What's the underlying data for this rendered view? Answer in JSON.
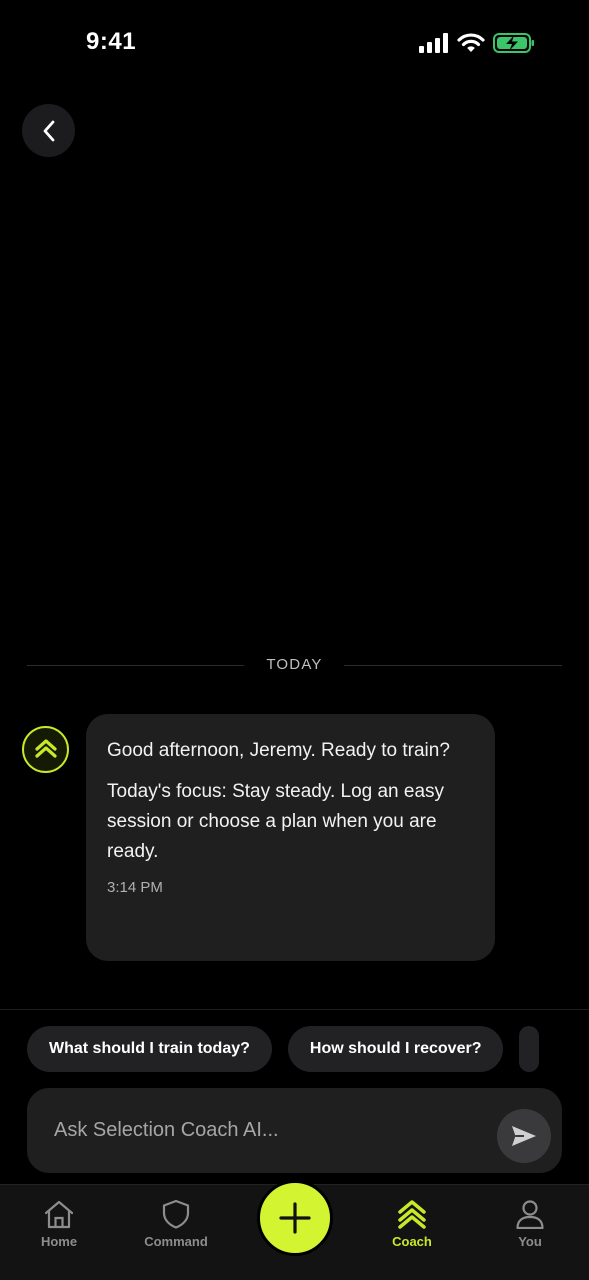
{
  "status_bar": {
    "time": "9:41"
  },
  "conversation": {
    "date_label": "TODAY",
    "message": {
      "line1": "Good afternoon, Jeremy. Ready to train?",
      "line2": "Today's focus: Stay steady. Log an easy session or choose a plan when you are ready.",
      "time": "3:14 PM"
    }
  },
  "suggestions": [
    "What should I train today?",
    "How should I recover?"
  ],
  "composer": {
    "placeholder": "Ask Selection Coach AI..."
  },
  "tab_bar": {
    "items": [
      {
        "label": "Home",
        "icon": "home-icon",
        "active": false
      },
      {
        "label": "Command",
        "icon": "shield-icon",
        "active": false
      },
      {
        "label": "Coach",
        "icon": "chevrons-up-icon",
        "active": true
      },
      {
        "label": "You",
        "icon": "person-icon",
        "active": false
      }
    ],
    "fab_icon": "plus-icon"
  },
  "colors": {
    "accent": "#c7e92a",
    "fab": "#d3f531",
    "bubble": "#1f1f1f",
    "background": "#000000"
  }
}
